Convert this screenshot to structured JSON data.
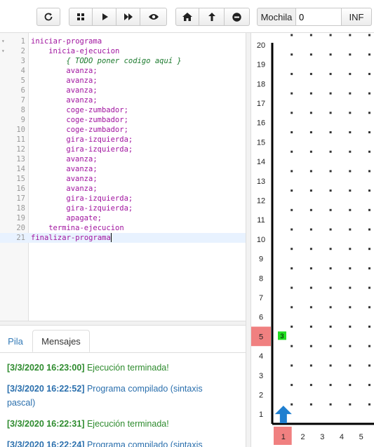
{
  "toolbar": {
    "reset_icon": "refresh-icon",
    "buttons": [
      "grid-icon",
      "play-icon",
      "fast-forward-icon",
      "eye-icon",
      "home-icon",
      "up-arrow-icon",
      "minus-circle-icon"
    ],
    "mochila_label": "Mochila",
    "mochila_value": "0",
    "inf_label": "INF"
  },
  "editor": {
    "lines": [
      {
        "n": "1",
        "indent": 0,
        "text": "iniciar-programa",
        "cls": "kw",
        "fold": true
      },
      {
        "n": "2",
        "indent": 4,
        "text": "inicia-ejecucion",
        "cls": "kw",
        "fold": true
      },
      {
        "n": "3",
        "indent": 8,
        "text": "{ TODO poner codigo aquí }",
        "cls": "cm"
      },
      {
        "n": "4",
        "indent": 8,
        "text": "avanza;",
        "cls": "kw"
      },
      {
        "n": "5",
        "indent": 8,
        "text": "avanza;",
        "cls": "kw"
      },
      {
        "n": "6",
        "indent": 8,
        "text": "avanza;",
        "cls": "kw"
      },
      {
        "n": "7",
        "indent": 8,
        "text": "avanza;",
        "cls": "kw"
      },
      {
        "n": "8",
        "indent": 8,
        "text": "coge-zumbador;",
        "cls": "kw"
      },
      {
        "n": "9",
        "indent": 8,
        "text": "coge-zumbador;",
        "cls": "kw"
      },
      {
        "n": "10",
        "indent": 8,
        "text": "coge-zumbador;",
        "cls": "kw"
      },
      {
        "n": "11",
        "indent": 8,
        "text": "gira-izquierda;",
        "cls": "kw"
      },
      {
        "n": "12",
        "indent": 8,
        "text": "gira-izquierda;",
        "cls": "kw"
      },
      {
        "n": "13",
        "indent": 8,
        "text": "avanza;",
        "cls": "kw"
      },
      {
        "n": "14",
        "indent": 8,
        "text": "avanza;",
        "cls": "kw"
      },
      {
        "n": "15",
        "indent": 8,
        "text": "avanza;",
        "cls": "kw"
      },
      {
        "n": "16",
        "indent": 8,
        "text": "avanza;",
        "cls": "kw"
      },
      {
        "n": "17",
        "indent": 8,
        "text": "gira-izquierda;",
        "cls": "kw"
      },
      {
        "n": "18",
        "indent": 8,
        "text": "gira-izquierda;",
        "cls": "kw"
      },
      {
        "n": "19",
        "indent": 8,
        "text": "apagate;",
        "cls": "kw"
      },
      {
        "n": "20",
        "indent": 4,
        "text": "termina-ejecucion",
        "cls": "kw"
      },
      {
        "n": "21",
        "indent": 0,
        "text": "finalizar-programa",
        "cls": "kw",
        "active": true
      }
    ]
  },
  "tabs": {
    "pila": "Pila",
    "mensajes": "Mensajes"
  },
  "messages": [
    {
      "ts": "[3/3/2020 16:23:00]",
      "text": " Ejecución terminada!",
      "color": "green"
    },
    {
      "ts": "[3/3/2020 16:22:52]",
      "text": " Programa compilado (sintaxis pascal)",
      "color": "blue"
    },
    {
      "ts": "[3/3/2020 16:22:31]",
      "text": " Ejecución terminada!",
      "color": "green"
    },
    {
      "ts": "[3/3/2020 16:22:24]",
      "text": " Programa compilado (sintaxis",
      "color": "blue"
    }
  ],
  "world": {
    "row_labels": [
      "20",
      "19",
      "18",
      "17",
      "16",
      "15",
      "14",
      "13",
      "12",
      "11",
      "10",
      "9",
      "8",
      "7",
      "6",
      "5",
      "4",
      "3",
      "2",
      "1"
    ],
    "col_labels": [
      "1",
      "2",
      "3",
      "4",
      "5"
    ],
    "highlight_row": "5",
    "highlight_col": "1",
    "beeper_count": "3",
    "robot_direction": "north",
    "colors": {
      "highlight": "#f08080",
      "beeper": "#22dd22",
      "robot": "#1f7fd0"
    }
  }
}
